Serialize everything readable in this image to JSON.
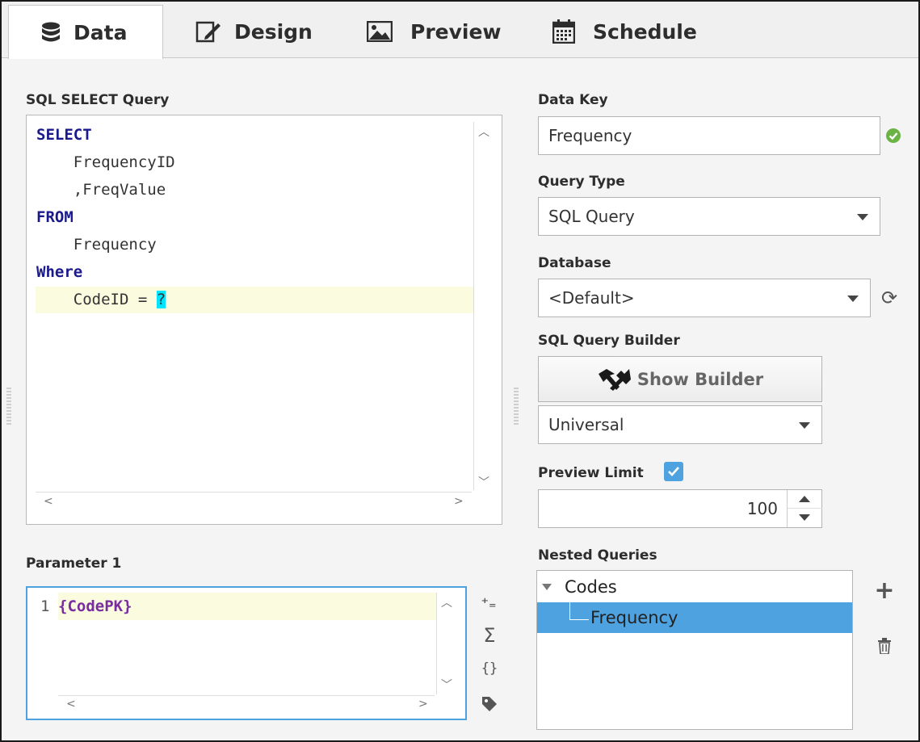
{
  "tabs": [
    {
      "label": "Data",
      "icon": "database-icon",
      "active": true
    },
    {
      "label": "Design",
      "icon": "edit-icon",
      "active": false
    },
    {
      "label": "Preview",
      "icon": "image-icon",
      "active": false
    },
    {
      "label": "Schedule",
      "icon": "calendar-icon",
      "active": false
    }
  ],
  "query": {
    "label": "SQL SELECT Query",
    "lines": [
      "SELECT",
      "    FrequencyID",
      "    ,FreqValue",
      "FROM",
      "    Frequency",
      "Where",
      "    CodeID = ",
      "?"
    ]
  },
  "parameter": {
    "label": "Parameter 1",
    "line_number": "1",
    "value": "{CodePK}"
  },
  "data_key": {
    "label": "Data Key",
    "value": "Frequency",
    "status": "valid"
  },
  "query_type": {
    "label": "Query Type",
    "value": "SQL Query"
  },
  "database": {
    "label": "Database",
    "value": "<Default>"
  },
  "builder": {
    "label": "SQL Query Builder",
    "button": "Show Builder",
    "dialect": "Universal"
  },
  "preview_limit": {
    "label": "Preview Limit",
    "checked": true,
    "value": "100"
  },
  "nested": {
    "label": "Nested Queries",
    "items": [
      {
        "label": "Codes",
        "expanded": true,
        "selected": false
      },
      {
        "label": "Frequency",
        "selected": true
      }
    ]
  },
  "colors": {
    "accent": "#4ea2e0",
    "valid": "#6ab344",
    "keyword": "#1a1a8c",
    "param_hl": "#00e5ff",
    "line_hl": "#fbfbdf"
  }
}
